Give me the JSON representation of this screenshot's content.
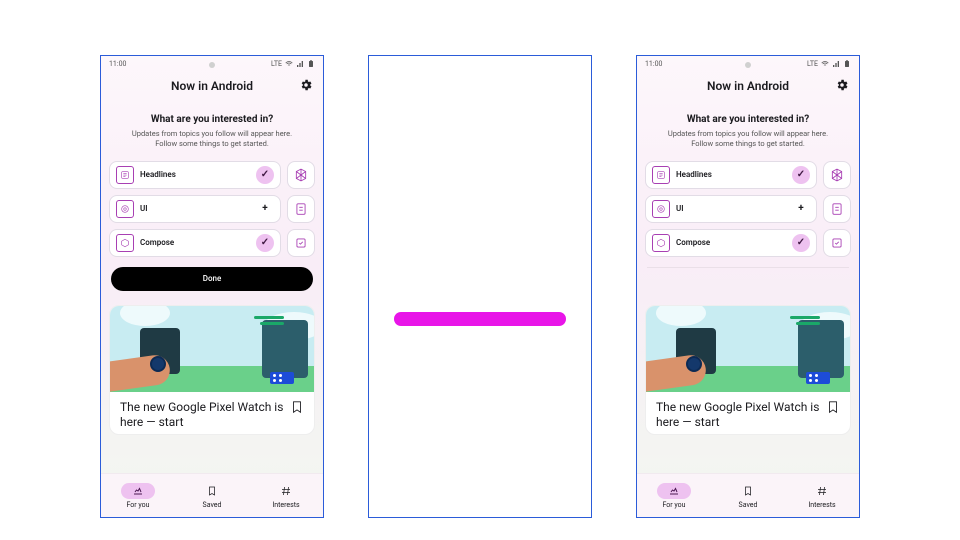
{
  "statusbar": {
    "time": "11:00",
    "net": "LTE"
  },
  "header": {
    "title": "Now in Android"
  },
  "onboarding": {
    "title": "What are you interested in?",
    "subtitle": "Updates from topics you follow will appear here. Follow some things to get started."
  },
  "topics": [
    {
      "label": "Headlines",
      "followed": true
    },
    {
      "label": "UI",
      "followed": false
    },
    {
      "label": "Compose",
      "followed": true
    }
  ],
  "done_label": "Done",
  "card": {
    "title": "The new Google Pixel Watch is here — start"
  },
  "nav": {
    "for_you": "For you",
    "saved": "Saved",
    "interests": "Interests"
  }
}
